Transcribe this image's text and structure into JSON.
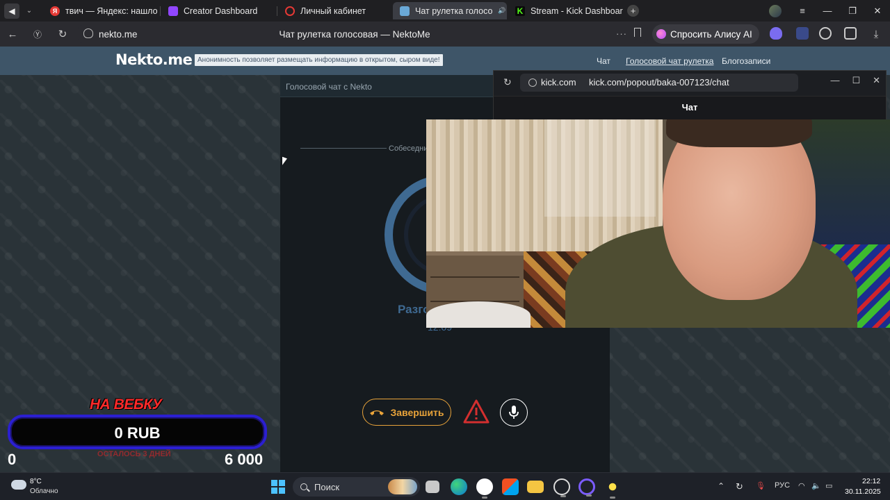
{
  "browser": {
    "tabs": [
      {
        "title": "твич — Яндекс: нашлось",
        "active": false
      },
      {
        "title": "Creator Dashboard",
        "active": false
      },
      {
        "title": "Личный кабинет",
        "active": false
      },
      {
        "title": "Чат рулетка голосо",
        "active": true
      },
      {
        "title": "Stream - Kick Dashboard",
        "active": false
      }
    ],
    "url": "nekto.me",
    "page_title": "Чат рулетка голосовая — NektoMe",
    "alice_label": "Спросить Алису AI"
  },
  "site": {
    "logo": "Nekto.me",
    "tagline": "Анонимность позволяет размещать информацию в открытом, сыром виде!",
    "nav": [
      "Чат",
      "Голосовой чат рулетка",
      "Блогозаписи"
    ],
    "panel_title": "Голосовой чат с Nekto",
    "separator_text": "Собеседни",
    "status_text": "Разго",
    "timer": "12:09",
    "end_button": "Завершить"
  },
  "overlay": {
    "title": "НА ВЕБКУ",
    "value": "0 RUB",
    "subtitle": "ОСТАЛОСЬ 3 ДНЕЙ",
    "min": "0",
    "max": "6 000"
  },
  "popout": {
    "domain": "kick.com",
    "url": "kick.com/popout/baka-007123/chat",
    "chat_title": "Чат"
  },
  "taskbar": {
    "temperature": "8°C",
    "weather": "Облачно",
    "search_placeholder": "Поиск",
    "language": "РУС",
    "time": "22:12",
    "date": "30.11.2025"
  },
  "colors": {
    "site_header": "#3e5568",
    "accent_ring": "#3f6a92",
    "end_button": "#e8a33a",
    "overlay_title": "#ff2a2a",
    "overlay_border": "#2b1fd1"
  }
}
